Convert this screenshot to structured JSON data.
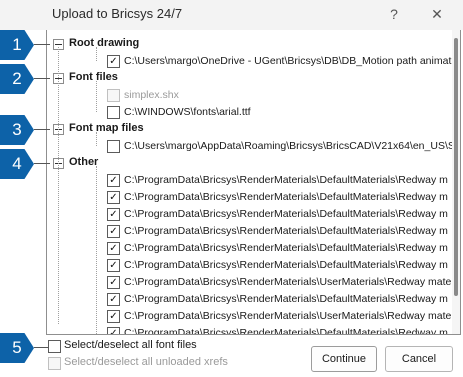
{
  "window": {
    "title": "Upload to Bricsys 24/7",
    "help_glyph": "?",
    "close_glyph": "✕"
  },
  "groups": [
    {
      "label": "Root drawing",
      "items": [
        {
          "text": "C:\\Users\\margo\\OneDrive - UGent\\Bricsys\\DB\\DB_Motion path animat",
          "checked": true,
          "enabled": true
        }
      ]
    },
    {
      "label": "Font files",
      "items": [
        {
          "text": "simplex.shx",
          "checked": false,
          "enabled": false
        },
        {
          "text": "C:\\WINDOWS\\fonts\\arial.ttf",
          "checked": false,
          "enabled": true
        }
      ]
    },
    {
      "label": "Font map files",
      "items": [
        {
          "text": "C:\\Users\\margo\\AppData\\Roaming\\Bricsys\\BricsCAD\\V21x64\\en_US\\S",
          "checked": false,
          "enabled": true
        }
      ]
    },
    {
      "label": "Other",
      "items": [
        {
          "text": "C:\\ProgramData\\Bricsys\\RenderMaterials\\DefaultMaterials\\Redway m",
          "checked": true,
          "enabled": true
        },
        {
          "text": "C:\\ProgramData\\Bricsys\\RenderMaterials\\DefaultMaterials\\Redway m",
          "checked": true,
          "enabled": true
        },
        {
          "text": "C:\\ProgramData\\Bricsys\\RenderMaterials\\DefaultMaterials\\Redway m",
          "checked": true,
          "enabled": true
        },
        {
          "text": "C:\\ProgramData\\Bricsys\\RenderMaterials\\DefaultMaterials\\Redway m",
          "checked": true,
          "enabled": true
        },
        {
          "text": "C:\\ProgramData\\Bricsys\\RenderMaterials\\DefaultMaterials\\Redway m",
          "checked": true,
          "enabled": true
        },
        {
          "text": "C:\\ProgramData\\Bricsys\\RenderMaterials\\DefaultMaterials\\Redway m",
          "checked": true,
          "enabled": true
        },
        {
          "text": "C:\\ProgramData\\Bricsys\\RenderMaterials\\UserMaterials\\Redway mate",
          "checked": true,
          "enabled": true
        },
        {
          "text": "C:\\ProgramData\\Bricsys\\RenderMaterials\\DefaultMaterials\\Redway m",
          "checked": true,
          "enabled": true
        },
        {
          "text": "C:\\ProgramData\\Bricsys\\RenderMaterials\\UserMaterials\\Redway mate",
          "checked": true,
          "enabled": true
        },
        {
          "text": "C:\\ProgramData\\Bricsys\\RenderMaterials\\DefaultMaterials\\Redway m",
          "checked": true,
          "enabled": true
        }
      ]
    }
  ],
  "footer": {
    "select_font_files": {
      "label": "Select/deselect all font files",
      "checked": false,
      "enabled": true
    },
    "select_unloaded_xrefs": {
      "label": "Select/deselect all unloaded xrefs",
      "checked": false,
      "enabled": false
    }
  },
  "buttons": {
    "continue": "Continue",
    "cancel": "Cancel"
  },
  "callouts": [
    "1",
    "2",
    "3",
    "4",
    "5"
  ],
  "colors": {
    "callout_badge": "#0d62a8",
    "titlebar_bg": "#f3f3f3",
    "disabled_text": "#9a9a9a"
  },
  "icons": {
    "check": "✓",
    "collapse": "collapse-minus-icon"
  }
}
